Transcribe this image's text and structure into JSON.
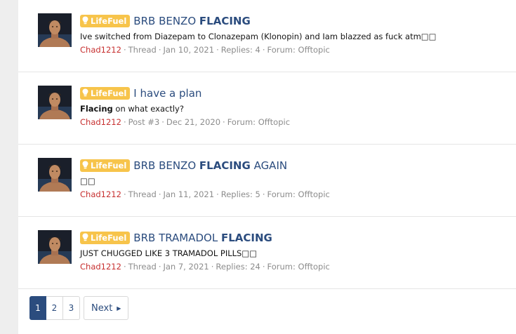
{
  "badge_label": "LifeFuel",
  "results": [
    {
      "title_before": "BRB BENZO ",
      "title_highlight": "FLACING",
      "title_after": "",
      "snippet_highlight": "",
      "snippet": "Ive switched from Diazepam to Clonazepam (Klonopin) and Iam blazzed as fuck atm□□",
      "user": "Chad1212",
      "type": "Thread",
      "date": "Jan 10, 2021",
      "extra": "Replies: 4",
      "forum": "Forum: Offtopic"
    },
    {
      "title_before": "I have a plan",
      "title_highlight": "",
      "title_after": "",
      "snippet_highlight": "Flacing",
      "snippet": " on what exactly?",
      "user": "Chad1212",
      "type": "Post #3",
      "date": "Dec 21, 2020",
      "extra": "",
      "forum": "Forum: Offtopic"
    },
    {
      "title_before": "BRB BENZO ",
      "title_highlight": "FLACING",
      "title_after": " AGAIN",
      "snippet_highlight": "",
      "snippet": "□□",
      "user": "Chad1212",
      "type": "Thread",
      "date": "Jan 11, 2021",
      "extra": "Replies: 5",
      "forum": "Forum: Offtopic"
    },
    {
      "title_before": "BRB TRAMADOL ",
      "title_highlight": "FLACING",
      "title_after": "",
      "snippet_highlight": "",
      "snippet": "JUST CHUGGED LIKE 3 TRAMADOL PILLS□□",
      "user": "Chad1212",
      "type": "Thread",
      "date": "Jan 7, 2021",
      "extra": "Replies: 24",
      "forum": "Forum: Offtopic"
    }
  ],
  "pagination": {
    "pages": [
      "1",
      "2",
      "3"
    ],
    "current": "1",
    "next_label": "Next"
  },
  "colors": {
    "link": "#2b4c7e",
    "badge": "#f7c44b",
    "username": "#c73030",
    "meta": "#8c8c8c"
  },
  "icons": {
    "badge": "lightbulb-icon",
    "next": "chevron-right-icon"
  }
}
